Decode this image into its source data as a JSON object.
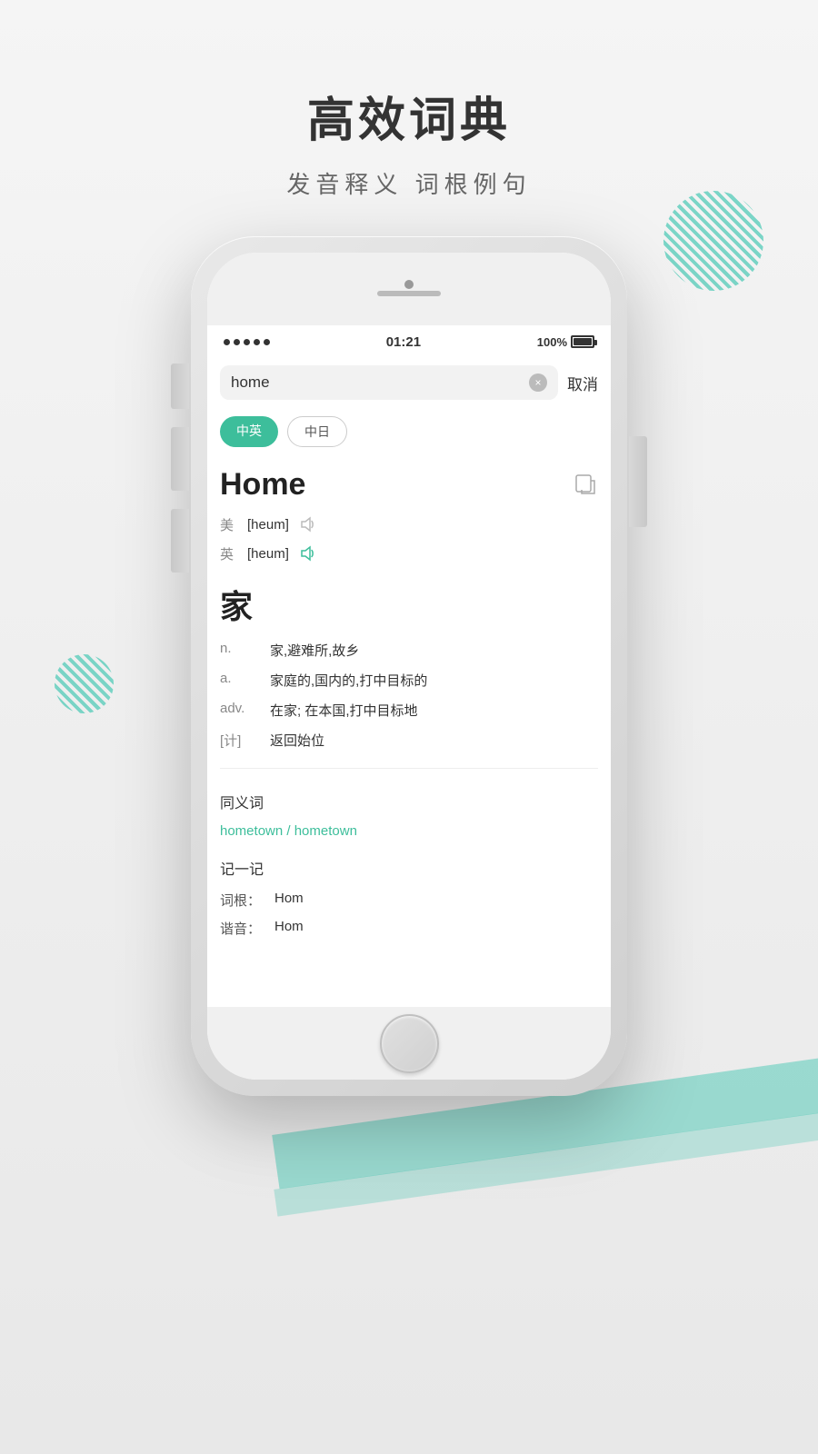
{
  "page": {
    "title": "高效词典",
    "subtitle": "发音释义  词根例句"
  },
  "status_bar": {
    "dots_count": 5,
    "time": "01:21",
    "battery_text": "100%"
  },
  "search": {
    "value": "home",
    "clear_label": "×",
    "cancel_label": "取消"
  },
  "lang_tabs": [
    {
      "label": "中英",
      "active": true
    },
    {
      "label": "中日",
      "active": false
    }
  ],
  "entry": {
    "word": "Home",
    "pronunciations": [
      {
        "region": "美",
        "phonetic": "[heum]"
      },
      {
        "region": "英",
        "phonetic": "[heum]"
      }
    ],
    "chinese": "家",
    "definitions": [
      {
        "type": "n.",
        "text": "家,避难所,故乡"
      },
      {
        "type": "a.",
        "text": "家庭的,国内的,打中目标的"
      },
      {
        "type": "adv.",
        "text": "在家; 在本国,打中目标地"
      },
      {
        "type": "[计]",
        "text": "返回始位"
      }
    ],
    "synonyms_title": "同义词",
    "synonyms": "hometown / hometown",
    "memory_title": "记一记",
    "word_root_label": "词根：",
    "word_root_value": "Hom",
    "sound_label": "谐音：",
    "sound_value": "Hom"
  }
}
